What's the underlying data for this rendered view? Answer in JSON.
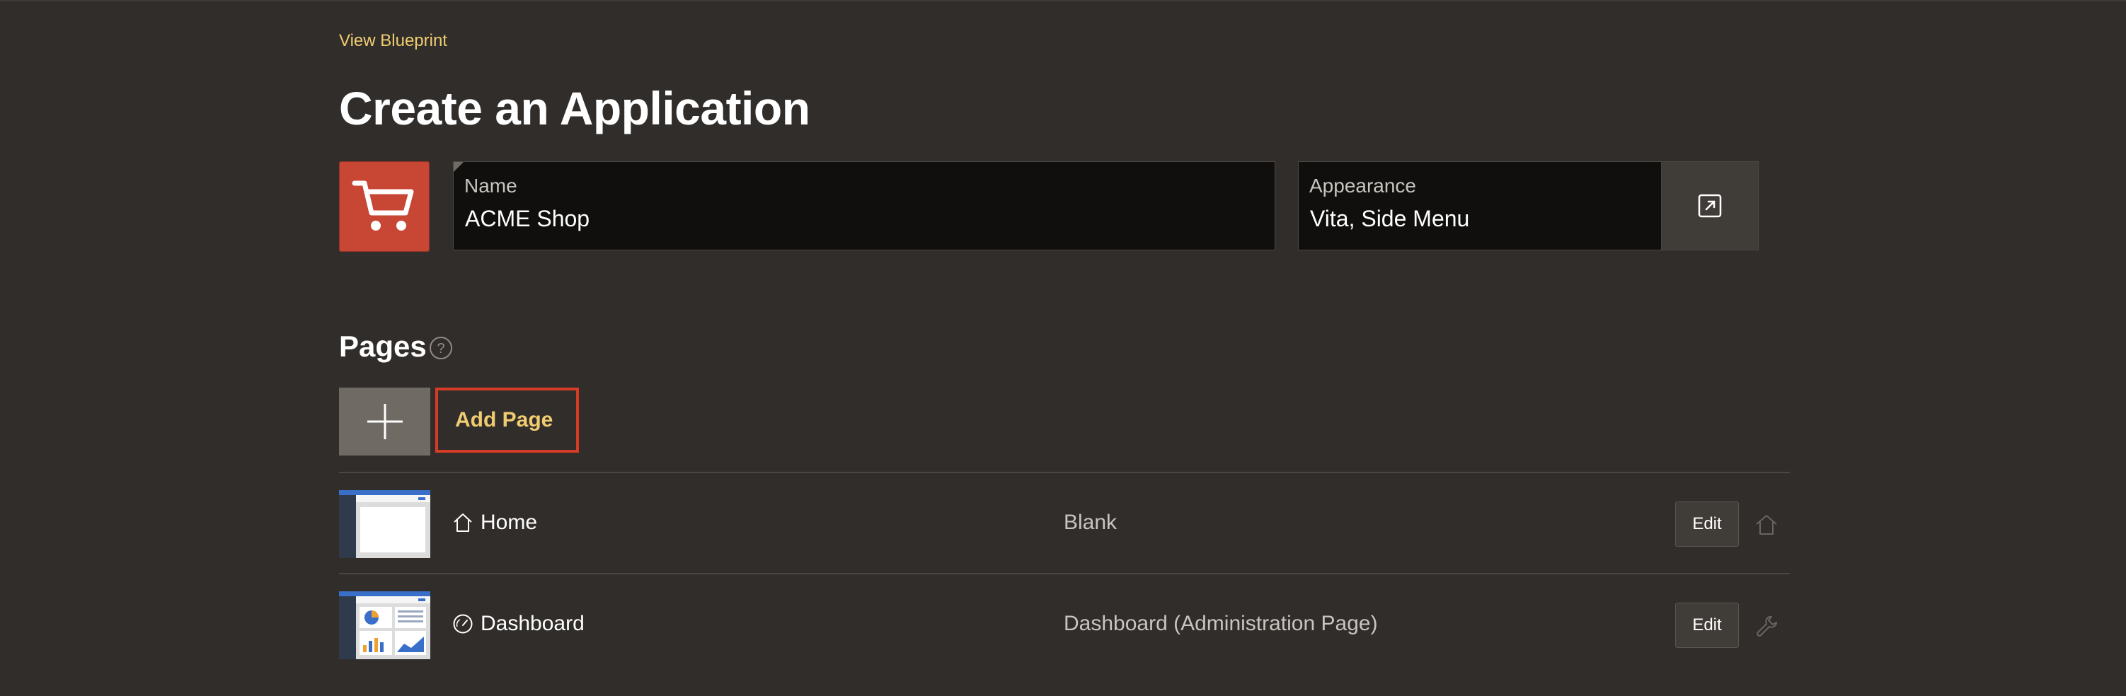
{
  "header": {
    "view_blueprint": "View Blueprint",
    "title": "Create an Application"
  },
  "app_icon": {
    "icon": "shopping-cart-icon",
    "color": "#c74634"
  },
  "name_field": {
    "label": "Name",
    "value": "ACME Shop"
  },
  "appearance_field": {
    "label": "Appearance",
    "value": "Vita, Side Menu"
  },
  "appearance_button": {
    "icon": "external-link-icon"
  },
  "pages": {
    "heading": "Pages",
    "help_icon": "question-circle-icon",
    "add_button_icon": "plus-icon",
    "add_page_label": "Add Page",
    "rows": [
      {
        "name": "Home",
        "type": "Blank",
        "icon": "home-icon",
        "edit_label": "Edit",
        "end_icon": "home-icon"
      },
      {
        "name": "Dashboard",
        "type": "Dashboard (Administration Page)",
        "icon": "gauge-icon",
        "edit_label": "Edit",
        "end_icon": "wrench-icon"
      }
    ]
  },
  "colors": {
    "background": "#312d2a",
    "accent_link": "#f0cc71",
    "highlight_border": "#d63b25"
  }
}
